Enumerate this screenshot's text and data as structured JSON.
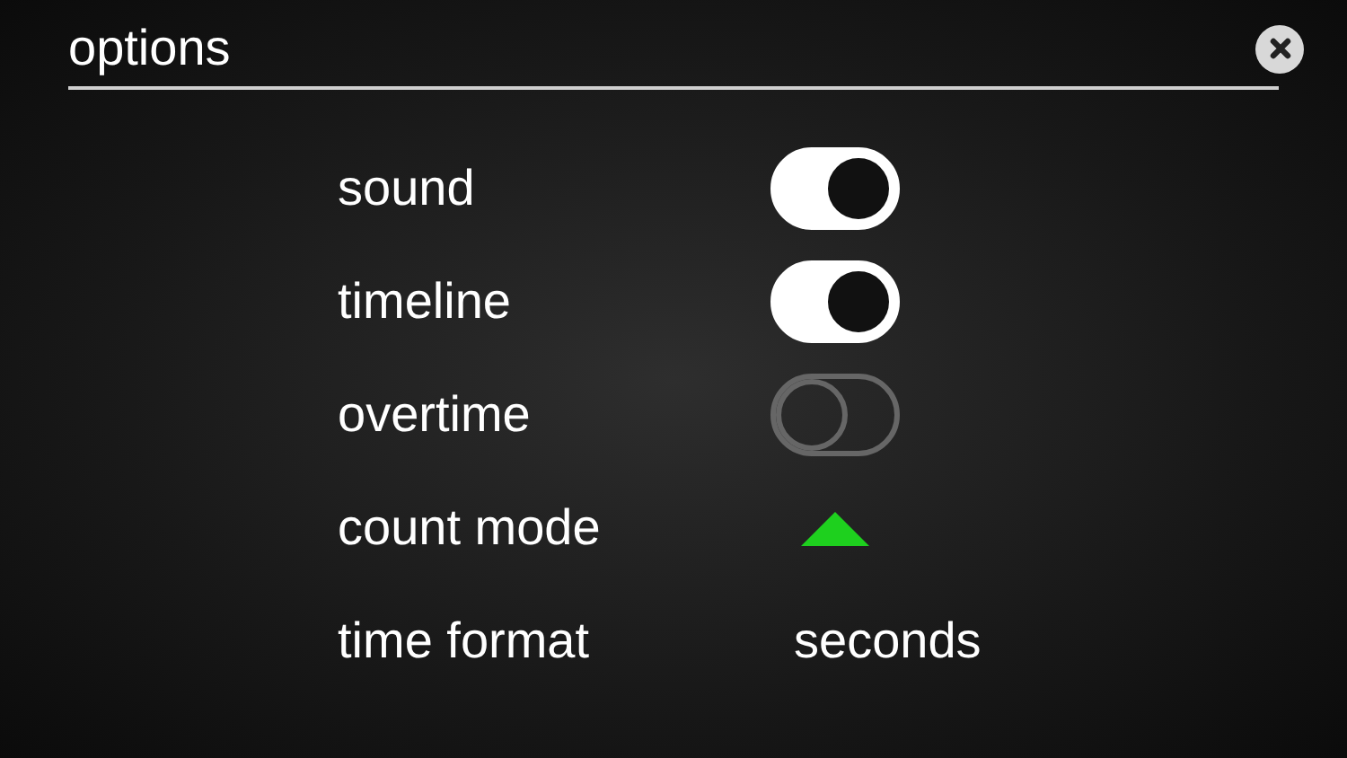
{
  "title": "options",
  "rows": [
    {
      "label": "sound",
      "kind": "toggle",
      "on": true
    },
    {
      "label": "timeline",
      "kind": "toggle",
      "on": true
    },
    {
      "label": "overtime",
      "kind": "toggle",
      "on": false
    },
    {
      "label": "count mode",
      "kind": "direction",
      "up": true
    },
    {
      "label": "time format",
      "kind": "value",
      "value": "seconds"
    }
  ]
}
